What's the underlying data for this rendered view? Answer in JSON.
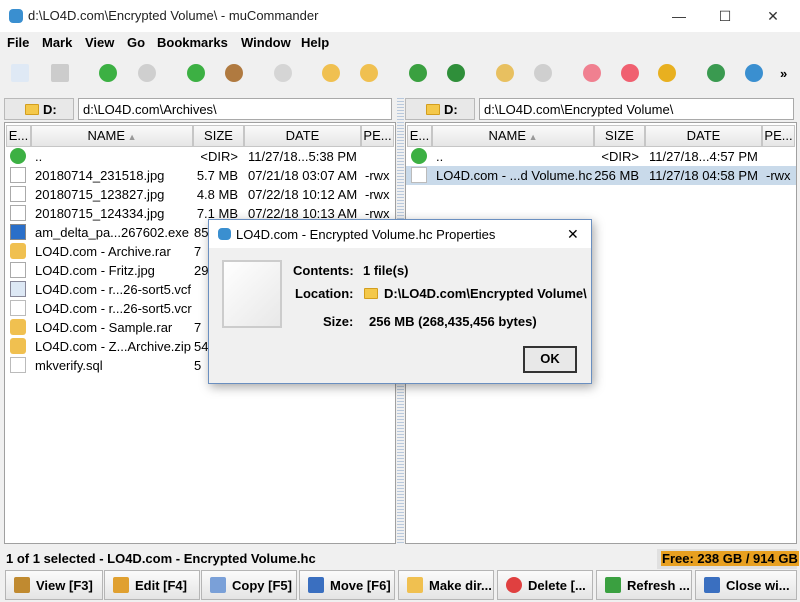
{
  "window": {
    "title": "d:\\LO4D.com\\Encrypted Volume\\ - muCommander",
    "minimize": "—",
    "maximize": "☐",
    "close": "✕"
  },
  "menu": [
    "File",
    "Mark",
    "View",
    "Go",
    "Bookmarks",
    "Window",
    "Help"
  ],
  "toolbar": {
    "icons": [
      "new-window-icon",
      "new-remote-connection-icon",
      "back-icon",
      "forward-icon",
      "parent-folder-icon",
      "home-icon",
      "stop-icon",
      "mark-icon",
      "unmark-icon",
      "refresh-icon",
      "swap-panels-icon",
      "pack-icon",
      "unpack-icon",
      "add-bookmark-icon",
      "edit-bookmarks-icon",
      "credentials-icon",
      "network-icon",
      "browser-icon"
    ],
    "more": "»"
  },
  "left": {
    "drive": "D:",
    "path": "d:\\LO4D.com\\Archives\\",
    "columns": [
      "E...",
      "NAME",
      "SIZE",
      "DATE",
      "PE..."
    ],
    "rows": [
      {
        "icon": "parent",
        "name": "..",
        "size": "<DIR>",
        "date": "11/27/18...5:38 PM",
        "perm": ""
      },
      {
        "icon": "image",
        "name": "20180714_231518.jpg",
        "size": "5.7 MB",
        "date": "07/21/18 03:07 AM",
        "perm": "-rwx"
      },
      {
        "icon": "image",
        "name": "20180715_123827.jpg",
        "size": "4.8 MB",
        "date": "07/22/18 10:12 AM",
        "perm": "-rwx"
      },
      {
        "icon": "image",
        "name": "20180715_124334.jpg",
        "size": "7.1 MB",
        "date": "07/22/18 10:13 AM",
        "perm": "-rwx"
      },
      {
        "icon": "exe",
        "name": "am_delta_pa...267602.exe",
        "size": "85",
        "date": "",
        "perm": ""
      },
      {
        "icon": "archive",
        "name": "LO4D.com - Archive.rar",
        "size": "7",
        "date": "",
        "perm": ""
      },
      {
        "icon": "image",
        "name": "LO4D.com - Fritz.jpg",
        "size": "29",
        "date": "",
        "perm": ""
      },
      {
        "icon": "vcard",
        "name": "LO4D.com - r...26-sort5.vcf",
        "size": "",
        "date": "",
        "perm": ""
      },
      {
        "icon": "file",
        "name": "LO4D.com - r...26-sort5.vcr",
        "size": "",
        "date": "",
        "perm": ""
      },
      {
        "icon": "archive",
        "name": "LO4D.com - Sample.rar",
        "size": "7",
        "date": "",
        "perm": ""
      },
      {
        "icon": "archive",
        "name": "LO4D.com - Z...Archive.zip",
        "size": "54",
        "date": "",
        "perm": ""
      },
      {
        "icon": "file",
        "name": "mkverify.sql",
        "size": "5",
        "date": "",
        "perm": ""
      }
    ]
  },
  "right": {
    "drive": "D:",
    "path": "d:\\LO4D.com\\Encrypted Volume\\",
    "columns": [
      "E...",
      "NAME",
      "SIZE",
      "DATE",
      "PE..."
    ],
    "rows": [
      {
        "icon": "parent",
        "name": "..",
        "size": "<DIR>",
        "date": "11/27/18...4:57 PM",
        "perm": ""
      },
      {
        "icon": "file",
        "name": "LO4D.com - ...d Volume.hc",
        "size": "256 MB",
        "date": "11/27/18 04:58 PM",
        "perm": "-rwx",
        "selected": true
      }
    ]
  },
  "status": {
    "text": "1 of 1 selected - LO4D.com - Encrypted Volume.hc",
    "free": "Free: 238 GB / 914 GB"
  },
  "buttons": [
    "View [F3]",
    "Edit [F4]",
    "Copy [F5]",
    "Move [F6]",
    "Make dir...",
    "Delete [...",
    "Refresh ...",
    "Close wi..."
  ],
  "dialog": {
    "title": "LO4D.com - Encrypted Volume.hc Properties",
    "close": "✕",
    "contents_label": "Contents:",
    "contents": "1 file(s)",
    "location_label": "Location:",
    "location": "D:\\LO4D.com\\Encrypted Volume\\",
    "size_label": "Size:",
    "size": "256 MB (268,435,456 bytes)",
    "ok": "OK"
  },
  "colors": {
    "selection": "#c9daea",
    "free_highlight": "#e8a020",
    "accent": "#6a8fc0"
  }
}
